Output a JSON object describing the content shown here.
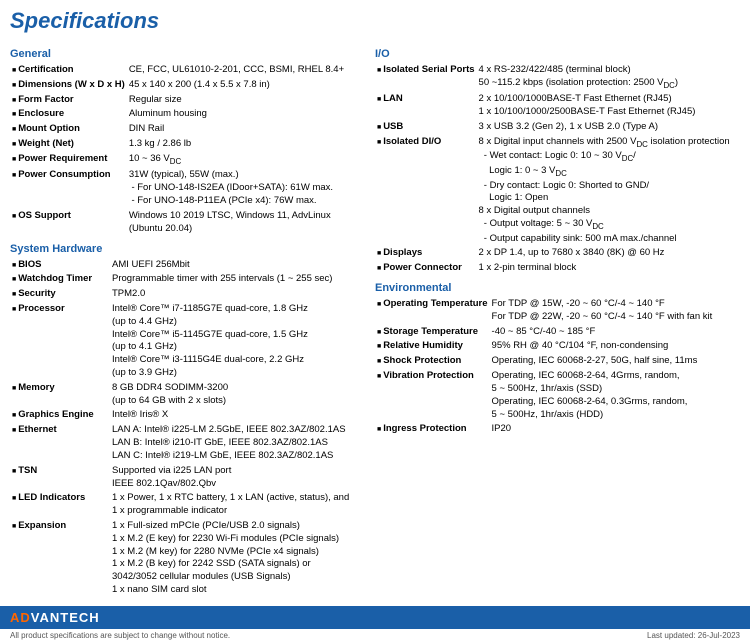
{
  "page": {
    "title": "Specifications"
  },
  "left": {
    "sections": [
      {
        "title": "General",
        "rows": [
          {
            "label": "Certification",
            "value": "CE, FCC, UL61010-2-201, CCC, BSMI, RHEL 8.4+"
          },
          {
            "label": "Dimensions (W x D x H)",
            "value": "45 x 140 x 200 (1.4 x 5.5 x 7.8 in)"
          },
          {
            "label": "Form Factor",
            "value": "Regular size"
          },
          {
            "label": "Enclosure",
            "value": "Aluminum housing"
          },
          {
            "label": "Mount Option",
            "value": "DIN Rail"
          },
          {
            "label": "Weight (Net)",
            "value": "1.3 kg / 2.86 lb"
          },
          {
            "label": "Power Requirement",
            "value": "10 ~ 36 VDC"
          },
          {
            "label": "Power Consumption",
            "value": "31W (typical), 55W (max.)\n- For UNO-148-IS2EA (IDoor+SATA): 61W max.\n- For UNO-148-P11EA (PCIe x4): 76W max."
          },
          {
            "label": "OS Support",
            "value": "Windows 10 2019 LTSC, Windows 11, AdvLinux\n(Ubuntu 20.04)"
          }
        ]
      },
      {
        "title": "System Hardware",
        "rows": [
          {
            "label": "BIOS",
            "value": "AMI UEFI 256Mbit"
          },
          {
            "label": "Watchdog Timer",
            "value": "Programmable timer with 255 intervals (1 ~ 255 sec)"
          },
          {
            "label": "Security",
            "value": "TPM2.0"
          },
          {
            "label": "Processor",
            "value": "Intel® Core™ i7-1185G7E quad-core, 1.8 GHz\n(up to 4.4 GHz)\nIntel® Core™ i5-1145G7E quad-core, 1.5 GHz\n(up to 4.1 GHz)\nIntel® Core™ i3-1115G4E dual-core, 2.2 GHz\n(up to 3.9 GHz)"
          },
          {
            "label": "Memory",
            "value": "8 GB DDR4 SODIMM-3200\n(up to 64 GB with 2 x slots)"
          },
          {
            "label": "Graphics Engine",
            "value": "Intel® Iris® X"
          },
          {
            "label": "Ethernet",
            "value": "LAN A: Intel® i225-LM 2.5GbE, IEEE 802.3AZ/802.1AS\nLAN B: Intel® i210-IT GbE, IEEE 802.3AZ/802.1AS\nLAN C: Intel® i219-LM GbE, IEEE 802.3AZ/802.1AS"
          },
          {
            "label": "TSN",
            "value": "Supported via i225 LAN port\nIEEE 802.1Qav/802.Qbv"
          },
          {
            "label": "LED Indicators",
            "value": "1 x Power, 1 x RTC battery, 1 x LAN (active, status), and\n1 x programmable indicator"
          },
          {
            "label": "Expansion",
            "value": "1 x Full-sized mPCIe (PCIe/USB 2.0 signals)\n1 x M.2 (E key) for 2230 Wi-Fi modules (PCIe signals)\n1 x M.2 (M key) for 2280 NVMe (PCIe x4 signals)\n1 x M.2 (B key) for 2242 SSD (SATA signals) or\n3042/3052 cellular modules (USB Signals)\n1 x nano SIM card slot"
          }
        ]
      }
    ]
  },
  "right": {
    "sections": [
      {
        "title": "I/O",
        "rows": [
          {
            "label": "Isolated Serial Ports",
            "value": "4 x RS-232/422/485 (terminal block)\n50 ~115.2 kbps (isolation protection: 2500 VDC)"
          },
          {
            "label": "LAN",
            "value": "2 x 10/100/1000BASE-T Fast Ethernet (RJ45)\n1 x 10/100/1000/2500BASE-T Fast Ethernet (RJ45)"
          },
          {
            "label": "USB",
            "value": "3 x USB 3.2 (Gen 2), 1 x USB 2.0 (Type A)"
          },
          {
            "label": "Isolated DI/O",
            "value": "8 x Digital input channels with 2500 VDC isolation protection\n– Wet contact: Logic 0: 10 ~ 30 VDC/\n  Logic 1: 0 ~ 3 VDC\n– Dry contact: Logic 0: Shorted to GND/\n  Logic 1: Open\n8 x Digital output channels\n– Output voltage: 5 ~ 30 VDC\n– Output capability sink: 500 mA max./channel"
          },
          {
            "label": "Displays",
            "value": "2 x DP 1.4, up to 7680 x 3840 (8K) @ 60 Hz"
          },
          {
            "label": "Power Connector",
            "value": "1 x 2-pin terminal block"
          }
        ]
      },
      {
        "title": "Environmental",
        "rows": [
          {
            "label": "Operating Temperature",
            "value": "For TDP @ 15W, -20 ~ 60 °C/-4 ~ 140 °F\nFor TDP @ 22W, -20 ~ 60 °C/-4 ~ 140 °F with fan kit"
          },
          {
            "label": "Storage Temperature",
            "value": "-40 ~ 85 °C/-40 ~ 185 °F"
          },
          {
            "label": "Relative Humidity",
            "value": "95% RH @ 40 °C/104 °F, non-condensing"
          },
          {
            "label": "Shock Protection",
            "value": "Operating, IEC 60068-2-27, 50G, half sine, 11ms"
          },
          {
            "label": "Vibration Protection",
            "value": "Operating, IEC 60068-2-64, 4Grms, random,\n5 ~ 500Hz, 1hr/axis (SSD)\nOperating, IEC 60068-2-64, 0.3Grms, random,\n5 ~ 500Hz, 1hr/axis (HDD)"
          },
          {
            "label": "Ingress Protection",
            "value": "IP20"
          }
        ]
      }
    ]
  },
  "footer": {
    "brand_prefix": "AD",
    "brand_suffix": "VANTECH",
    "note_left": "All product specifications are subject to change without notice.",
    "note_right": "Last updated: 26-Jul-2023"
  }
}
